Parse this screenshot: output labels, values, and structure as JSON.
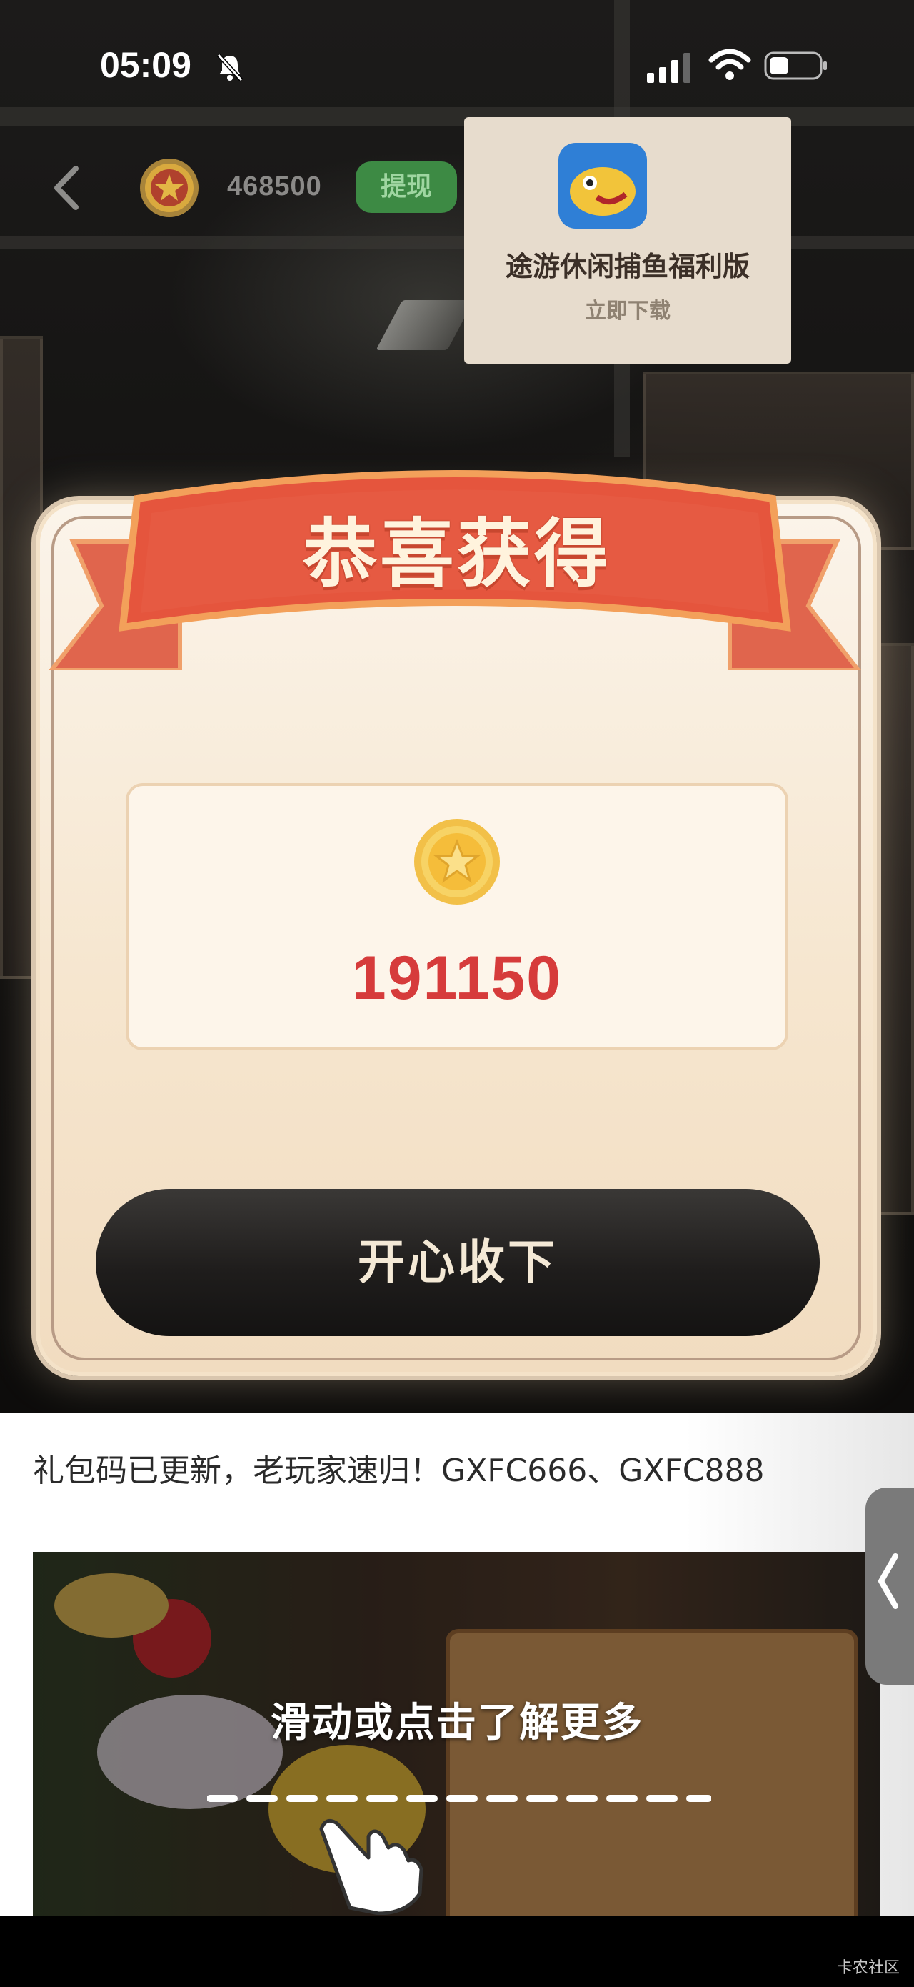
{
  "status_bar": {
    "time": "05:09"
  },
  "header": {
    "back_icon": "chevron-left-icon",
    "coin_icon": "gold-coin-icon",
    "balance": "468500",
    "withdraw_label": "提现"
  },
  "dialog": {
    "title": "恭喜获得",
    "reward_amount": "191150",
    "accept_label": "开心收下"
  },
  "article": {
    "text": "礼包码已更新，老玩家速归！GXFC666、GXFC888"
  },
  "ad": {
    "app_name": "途游休闲捕鱼福利版",
    "download_label": "立即下载",
    "swipe_hint": "滑动或点击了解更多"
  },
  "watermark": "卡农社区",
  "colors": {
    "withdraw_bg": "#3d8a44",
    "ribbon": "#e3593f",
    "amount": "#d63b3b",
    "accept_bg": "#1f1d1c"
  }
}
